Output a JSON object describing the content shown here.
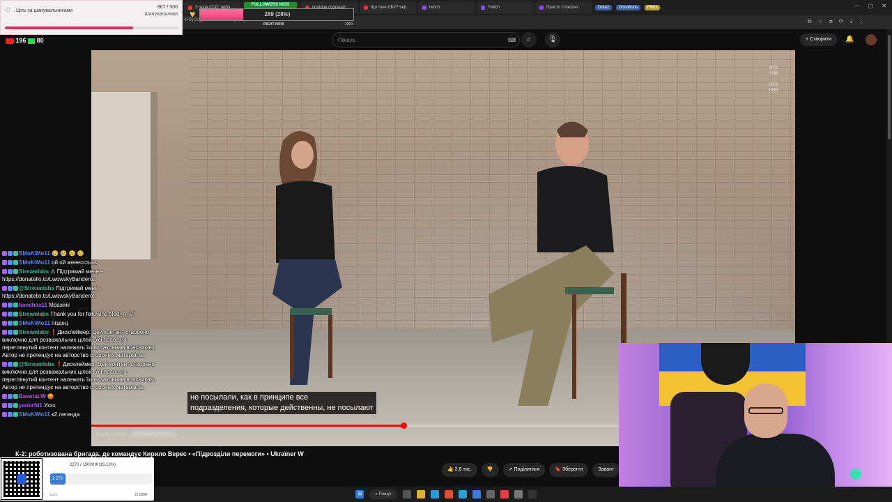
{
  "browser": {
    "tabs": [
      {
        "label": "З поля ССО: робо",
        "color": "#e33"
      },
      {
        "label": "Пекло Вугледара",
        "color": "#e33"
      },
      {
        "label": "youtube.com/watc",
        "color": "#e33"
      },
      {
        "label": "Що таке СБУ? Інф",
        "color": "#e33"
      },
      {
        "label": "twitch",
        "color": "#9146ff"
      },
      {
        "label": "Twitch",
        "color": "#9146ff"
      },
      {
        "label": "Просто стіакогнг",
        "color": "#9146ff"
      }
    ],
    "pills": [
      {
        "label": "Dota2",
        "color": "#3a5ea8"
      },
      {
        "label": "Donations",
        "color": "#3a5ea8"
      },
      {
        "label": "Films",
        "color": "#b8a02a"
      }
    ],
    "url_fragment": "4FByDLgg4ECABAIK-ndaQBMf_2x"
  },
  "youtube": {
    "search_placeholder": "Пошук",
    "create_label": "Створити",
    "video_title": "К-2: роботизована бригада, де командує Кирило Верес • «Підрозділи перемоги» • Ukraїner W",
    "subtitle_line1": "не посылали, как в принципе все",
    "subtitle_line2": "подразделения, которые действенны, не посылают",
    "time": "1:14:01 / 2:05:51",
    "chapter": "Створення роти К2",
    "progress": 0.59,
    "actions": {
      "likes": "2,6 тис.",
      "share": "Поділитися",
      "save": "Зберегти",
      "download": "Завант"
    },
    "rtx_top": "RTX VSR",
    "rtx_bottom": "RTX HDR"
  },
  "overlays": {
    "goal": {
      "title": "Ціль за шанувальниками",
      "count": "367 / 500",
      "sub": "Шанувальники",
      "fraction": 0.734
    },
    "kick": {
      "label": "FOLLOWERS KICK",
      "text": "289 (28%)",
      "fraction": 0.28,
      "right_now": "RIGHT NOW",
      "max": "1000"
    },
    "viewers": {
      "youtube": "196",
      "kick": "80"
    },
    "donation": {
      "amount_text": "2270 / 15000 ₴ (15.13%)",
      "bar_text": "2 270",
      "fraction": 0.1513,
      "low": "Ціль",
      "high": "15 000₴"
    }
  },
  "chat": [
    {
      "nick": "SMoKiMo11",
      "nick_color": "#5b8cff",
      "text": "😢 😢 😢 😢"
    },
    {
      "nick": "SMoKiMo11",
      "nick_color": "#5b8cff",
      "text": "ой ой жееесстььь"
    },
    {
      "nick": "Streamlabs",
      "nick_color": "#31c3a2",
      "text": "⚠ Підтримай мене - https://donatello.to/LwowskyBanderos"
    },
    {
      "nick": "@Streamlabs",
      "nick_color": "#31c3a2",
      "text": "Підтримай мене - https://donatello.to/LwowskyBanderos"
    },
    {
      "nick": "banshaa11",
      "nick_color": "#b05cff",
      "text": "Мразіііііі"
    },
    {
      "nick": "Streamlabs",
      "nick_color": "#31c3a2",
      "text": "Thank you for following Ned_A_V!"
    },
    {
      "nick": "SMoKiMo11",
      "nick_color": "#5b8cff",
      "text": "піздец"
    },
    {
      "nick": "Streamlabs",
      "nick_color": "#31c3a2",
      "text": "❗Дисклеймер: Цей контент створено виключно для розважальних цілей. Усі права на переглянутий контент належать їхнім законним власникам. Автор не претендує на авторство сторонніх матеріалів."
    },
    {
      "nick": "@Streamlabs",
      "nick_color": "#31c3a2",
      "text": "❗Дисклеймер: Цей контент створено виключно для розважальних цілей. Усі права на переглянутий контент належать їхнім законним власникам. Автор не претендує на авторство сторонніх матеріалів."
    },
    {
      "nick": "BasotaLW",
      "nick_color": "#b05cff",
      "text": "😡"
    },
    {
      "nick": "yanbrfd1",
      "nick_color": "#b05cff",
      "text": "Уххх"
    },
    {
      "nick": "SMoKiMo11",
      "nick_color": "#5b8cff",
      "text": "к2 легенда"
    }
  ],
  "taskbar": {
    "search_label": "Пошук"
  }
}
